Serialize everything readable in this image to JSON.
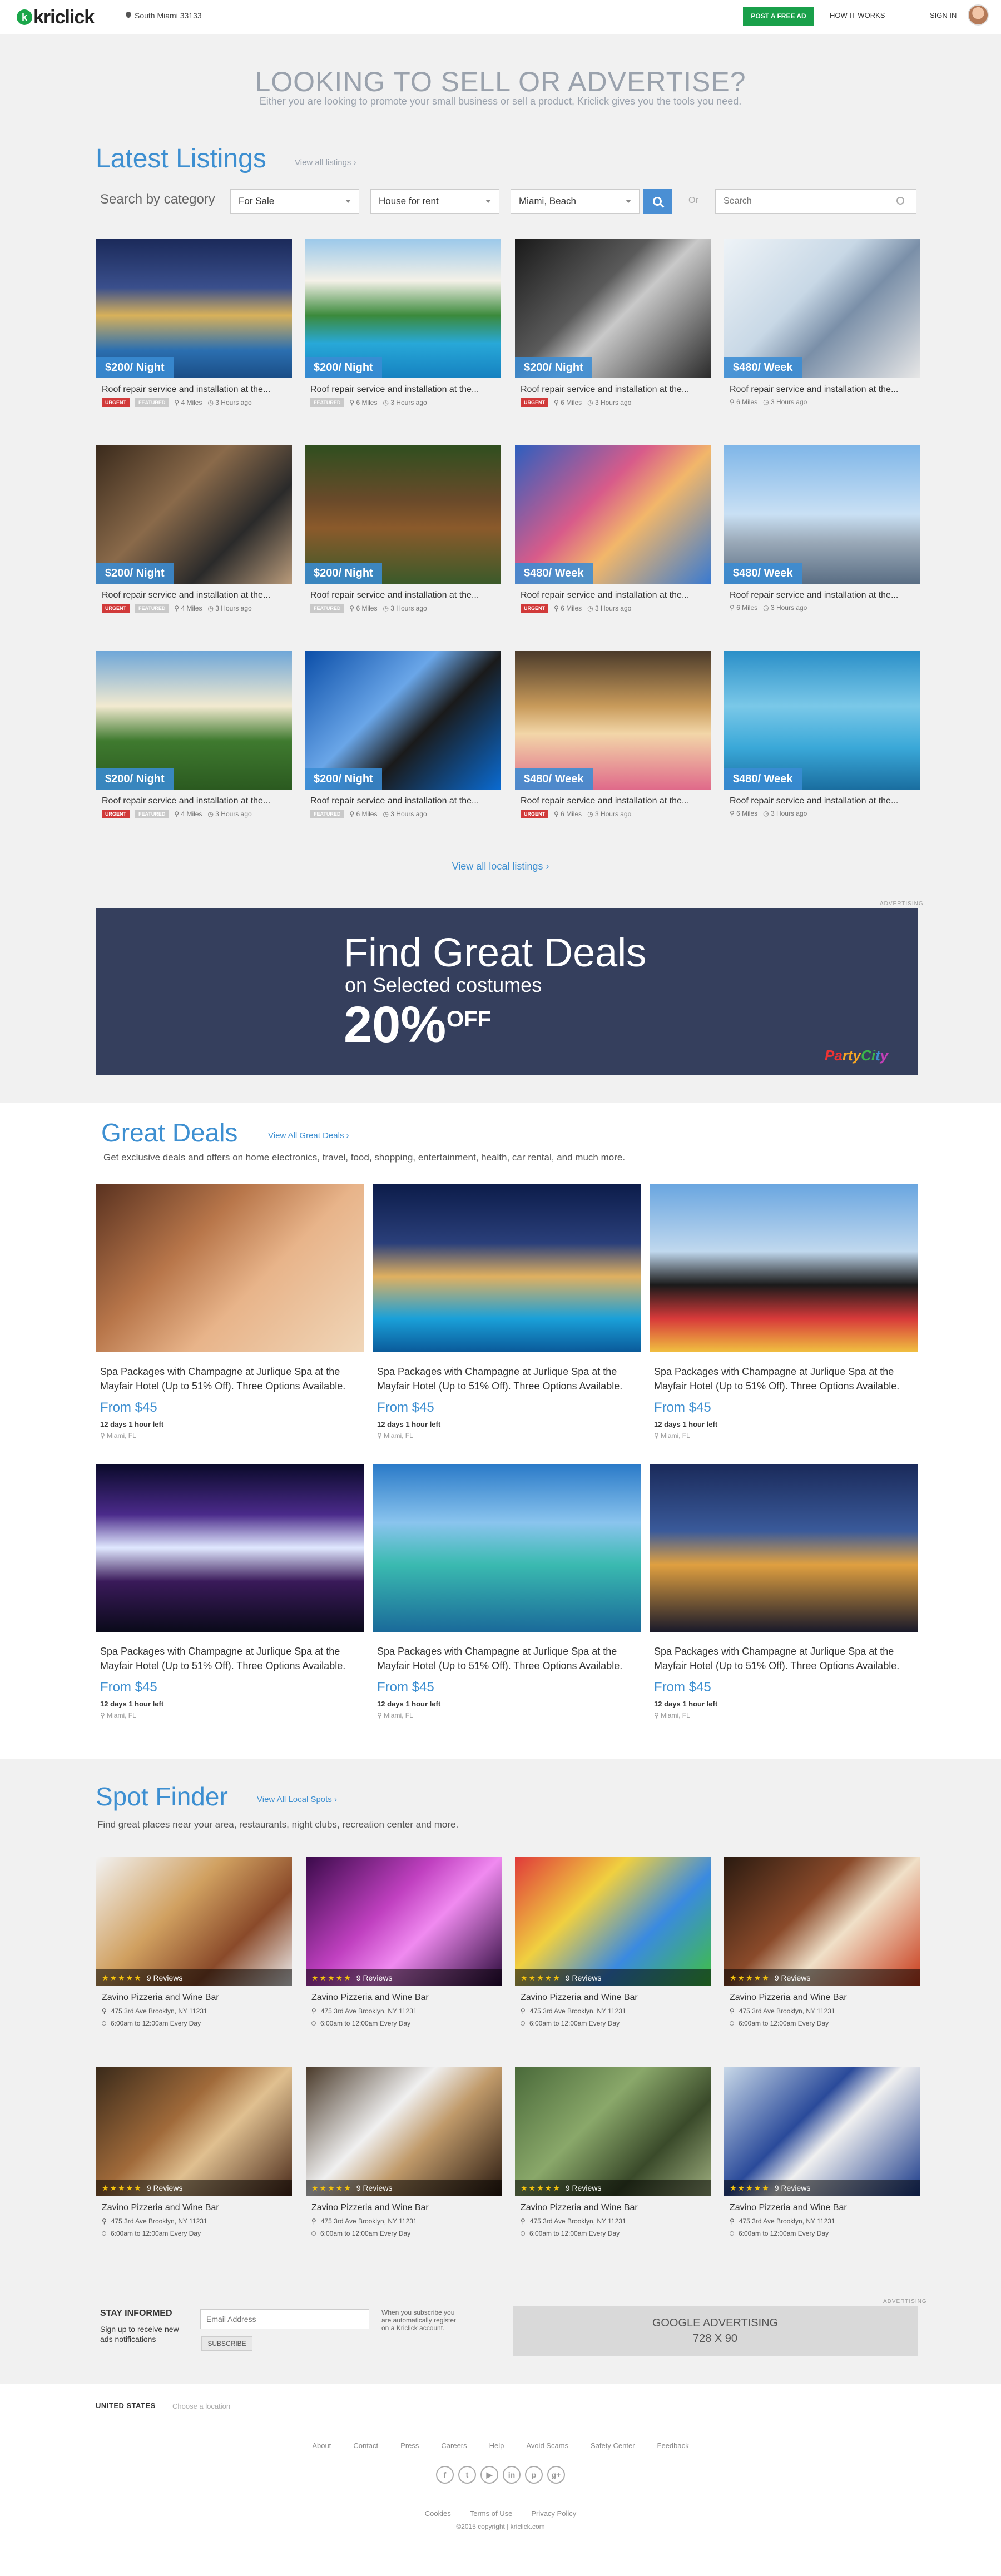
{
  "header": {
    "logo": "kriclick",
    "location": "South Miami 33133",
    "post_ad": "POST A FREE AD",
    "how_it_works": "HOW IT WORKS",
    "sign_in": "SIGN IN"
  },
  "hero": {
    "title": "LOOKING TO SELL OR ADVERTISE?",
    "subtitle": "Either you are looking to promote your small business or sell a product, Kriclick gives you the tools you need."
  },
  "listings": {
    "title": "Latest Listings",
    "view_all": "View all listings",
    "search_label": "Search by category",
    "select_1": "For Sale",
    "select_2": "House for rent",
    "select_3": "Miami, Beach",
    "or": "Or",
    "search_placeholder": "Search",
    "view_all_local": "View all local listings",
    "items": [
      {
        "price": "$200/ Night",
        "title": "Roof repair service and installation at the...",
        "urgent": "URGENT",
        "tag2": "FEATURED",
        "dist": "4 Miles",
        "time": "3 Hours ago"
      },
      {
        "price": "$200/ Night",
        "title": "Roof repair service and installation at the...",
        "urgent": "",
        "tag2": "FEATURED",
        "dist": "6 Miles",
        "time": "3 Hours ago"
      },
      {
        "price": "$200/ Night",
        "title": "Roof repair service and installation at the...",
        "urgent": "URGENT",
        "tag2": "",
        "dist": "6 Miles",
        "time": "3 Hours ago"
      },
      {
        "price": "$480/ Week",
        "title": "Roof repair service and installation at the...",
        "urgent": "",
        "tag2": "",
        "dist": "6 Miles",
        "time": "3 Hours ago"
      },
      {
        "price": "$200/ Night",
        "title": "Roof repair service and installation at the...",
        "urgent": "URGENT",
        "tag2": "FEATURED",
        "dist": "4 Miles",
        "time": "3 Hours ago"
      },
      {
        "price": "$200/ Night",
        "title": "Roof repair service and installation at the...",
        "urgent": "",
        "tag2": "FEATURED",
        "dist": "6 Miles",
        "time": "3 Hours ago"
      },
      {
        "price": "$480/ Week",
        "title": "Roof repair service and installation at the...",
        "urgent": "URGENT",
        "tag2": "",
        "dist": "6 Miles",
        "time": "3 Hours ago"
      },
      {
        "price": "$480/ Week",
        "title": "Roof repair service and installation at the...",
        "urgent": "",
        "tag2": "",
        "dist": "6 Miles",
        "time": "3 Hours ago"
      },
      {
        "price": "$200/ Night",
        "title": "Roof repair service and installation at the...",
        "urgent": "URGENT",
        "tag2": "FEATURED",
        "dist": "4 Miles",
        "time": "3 Hours ago"
      },
      {
        "price": "$200/ Night",
        "title": "Roof repair service and installation at the...",
        "urgent": "",
        "tag2": "FEATURED",
        "dist": "6 Miles",
        "time": "3 Hours ago"
      },
      {
        "price": "$480/ Week",
        "title": "Roof repair service and installation at the...",
        "urgent": "URGENT",
        "tag2": "",
        "dist": "6 Miles",
        "time": "3 Hours ago"
      },
      {
        "price": "$480/ Week",
        "title": "Roof repair service and installation at the...",
        "urgent": "",
        "tag2": "",
        "dist": "6 Miles",
        "time": "3 Hours ago"
      }
    ]
  },
  "ad_label": "ADVERTISING",
  "banner": {
    "line1": "Find Great Deals",
    "line2": "on Selected costumes",
    "line3": "20%",
    "off": "OFF",
    "brand_parts": [
      "Pa",
      "rty",
      "Ci",
      "t",
      "y"
    ]
  },
  "deals": {
    "title": "Great Deals",
    "link": "View All Great Deals",
    "desc": "Get exclusive deals and offers on home electronics, travel, food, shopping, entertainment, health, car rental,  and much more.",
    "items": [
      {
        "title": "Spa Packages with Champagne at Jurlique Spa at the Mayfair Hotel (Up to 51% Off). Three Options Available.",
        "price": "From $45",
        "left": "12 days 1 hour left",
        "loc": "Miami, FL"
      },
      {
        "title": "Spa Packages with Champagne at Jurlique Spa at the Mayfair Hotel (Up to 51% Off). Three Options Available.",
        "price": "From $45",
        "left": "12 days 1 hour left",
        "loc": "Miami, FL"
      },
      {
        "title": "Spa Packages with Champagne at Jurlique Spa at the Mayfair Hotel (Up to 51% Off). Three Options Available.",
        "price": "From $45",
        "left": "12 days 1 hour left",
        "loc": "Miami, FL"
      },
      {
        "title": "Spa Packages with Champagne at Jurlique Spa at the Mayfair Hotel (Up to 51% Off). Three Options Available.",
        "price": "From $45",
        "left": "12 days 1 hour left",
        "loc": "Miami, FL"
      },
      {
        "title": "Spa Packages with Champagne at Jurlique Spa at the Mayfair Hotel (Up to 51% Off). Three Options Available.",
        "price": "From $45",
        "left": "12 days 1 hour left",
        "loc": "Miami, FL"
      },
      {
        "title": "Spa Packages with Champagne at Jurlique Spa at the Mayfair Hotel (Up to 51% Off). Three Options Available.",
        "price": "From $45",
        "left": "12 days 1 hour left",
        "loc": "Miami, FL"
      }
    ]
  },
  "spots": {
    "title": "Spot Finder",
    "link": "View All Local Spots",
    "desc": "Find great places near your area, restaurants, night clubs, recreation center and more.",
    "items": [
      {
        "reviews": "9 Reviews",
        "name": "Zavino Pizzeria and Wine Bar",
        "address": "475 3rd Ave Brooklyn, NY 11231",
        "hours": "6:00am to 12:00am Every Day"
      },
      {
        "reviews": "9 Reviews",
        "name": "Zavino Pizzeria and Wine Bar",
        "address": "475 3rd Ave Brooklyn, NY 11231",
        "hours": "6:00am to 12:00am Every Day"
      },
      {
        "reviews": "9 Reviews",
        "name": "Zavino Pizzeria and Wine Bar",
        "address": "475 3rd Ave Brooklyn, NY 11231",
        "hours": "6:00am to 12:00am Every Day"
      },
      {
        "reviews": "9 Reviews",
        "name": "Zavino Pizzeria and Wine Bar",
        "address": "475 3rd Ave Brooklyn, NY 11231",
        "hours": "6:00am to 12:00am Every Day"
      },
      {
        "reviews": "9 Reviews",
        "name": "Zavino Pizzeria and Wine Bar",
        "address": "475 3rd Ave Brooklyn, NY 11231",
        "hours": "6:00am to 12:00am Every Day"
      },
      {
        "reviews": "9 Reviews",
        "name": "Zavino Pizzeria and Wine Bar",
        "address": "475 3rd Ave Brooklyn, NY 11231",
        "hours": "6:00am to 12:00am Every Day"
      },
      {
        "reviews": "9 Reviews",
        "name": "Zavino Pizzeria and Wine Bar",
        "address": "475 3rd Ave Brooklyn, NY 11231",
        "hours": "6:00am to 12:00am Every Day"
      },
      {
        "reviews": "9 Reviews",
        "name": "Zavino Pizzeria and Wine Bar",
        "address": "475 3rd Ave Brooklyn, NY 11231",
        "hours": "6:00am to 12:00am Every Day"
      }
    ]
  },
  "newsletter": {
    "heading": "STAY INFORMED",
    "sub": "Sign up to receive new ads notifications",
    "placeholder": "Email Address",
    "button": "SUBSCRIBE",
    "note": "When you subscribe you are automatically register on a Kriclick account."
  },
  "google_ad": {
    "line1": "GOOGLE ADVERTISING",
    "line2": "728 X 90"
  },
  "footer": {
    "country": "UNITED STATES",
    "choose": "Choose a location",
    "links": [
      "About",
      "Contact",
      "Press",
      "Careers",
      "Help",
      "Avoid Scams",
      "Safety Center",
      "Feedback"
    ],
    "social_icons": [
      "facebook-icon",
      "twitter-icon",
      "youtube-icon",
      "linkedin-icon",
      "pinterest-icon",
      "googleplus-icon"
    ],
    "social_glyphs": [
      "f",
      "t",
      "▶",
      "in",
      "p",
      "g+"
    ],
    "legal": [
      "Cookies",
      "Terms of Use",
      "Privacy Policy"
    ],
    "copyright": "©2015 copyright  |  kriclick.com"
  },
  "colors": {
    "accent": "#3d8fd1",
    "brand_green": "#19a04a",
    "urgent": "#d13a3a",
    "banner": "#353f5d"
  }
}
